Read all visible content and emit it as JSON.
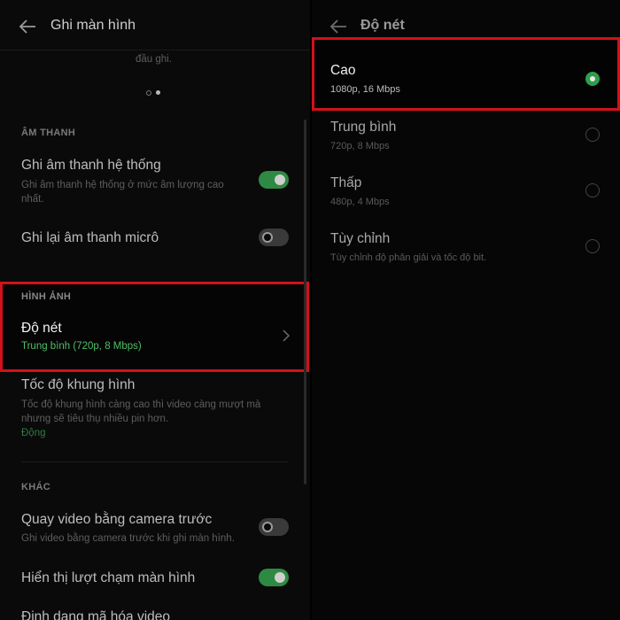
{
  "left": {
    "header_title": "Ghi màn hình",
    "top_fragment": "đầu ghi.",
    "sound": {
      "section_label": "ÂM THANH",
      "system_audio": {
        "title": "Ghi âm thanh hệ thống",
        "desc_line1": "Ghi âm thanh hệ thống ở mức âm lượng cao",
        "desc_line2": "nhất.",
        "enabled": true
      },
      "mic_audio": {
        "title": "Ghi lại âm thanh micrô",
        "enabled": false
      }
    },
    "image": {
      "section_label": "HÌNH ẢNH",
      "resolution": {
        "title": "Độ nét",
        "value": "Trung bình (720p, 8 Mbps)"
      },
      "frame_rate": {
        "title": "Tốc độ khung hình",
        "desc_line1": "Tốc độ khung hình càng cao thì video càng mượt mà",
        "desc_line2": "nhưng sẽ tiêu thụ nhiều pin hơn.",
        "value": "Động"
      }
    },
    "other": {
      "section_label": "KHÁC",
      "front_camera": {
        "title": "Quay video bằng camera trước",
        "desc": "Ghi video bằng camera trước khi ghi màn hình.",
        "enabled": false
      },
      "show_touches": {
        "title": "Hiển thị lượt chạm màn hình",
        "enabled": true
      },
      "encoding_title": "Định dạng mã hóa video"
    }
  },
  "right": {
    "header_title": "Độ nét",
    "options": [
      {
        "title": "Cao",
        "subtitle": "1080p, 16 Mbps",
        "selected": true
      },
      {
        "title": "Trung bình",
        "subtitle": "720p, 8 Mbps",
        "selected": false
      },
      {
        "title": "Thấp",
        "subtitle": "480p, 4 Mbps",
        "selected": false
      },
      {
        "title": "Tùy chỉnh",
        "subtitle": "Tùy chỉnh độ phân giải và tốc độ bit.",
        "selected": false
      }
    ]
  },
  "colors": {
    "accent_green": "#4fbf67",
    "highlight_red": "#d2111a",
    "background": "#0a0a0a"
  }
}
